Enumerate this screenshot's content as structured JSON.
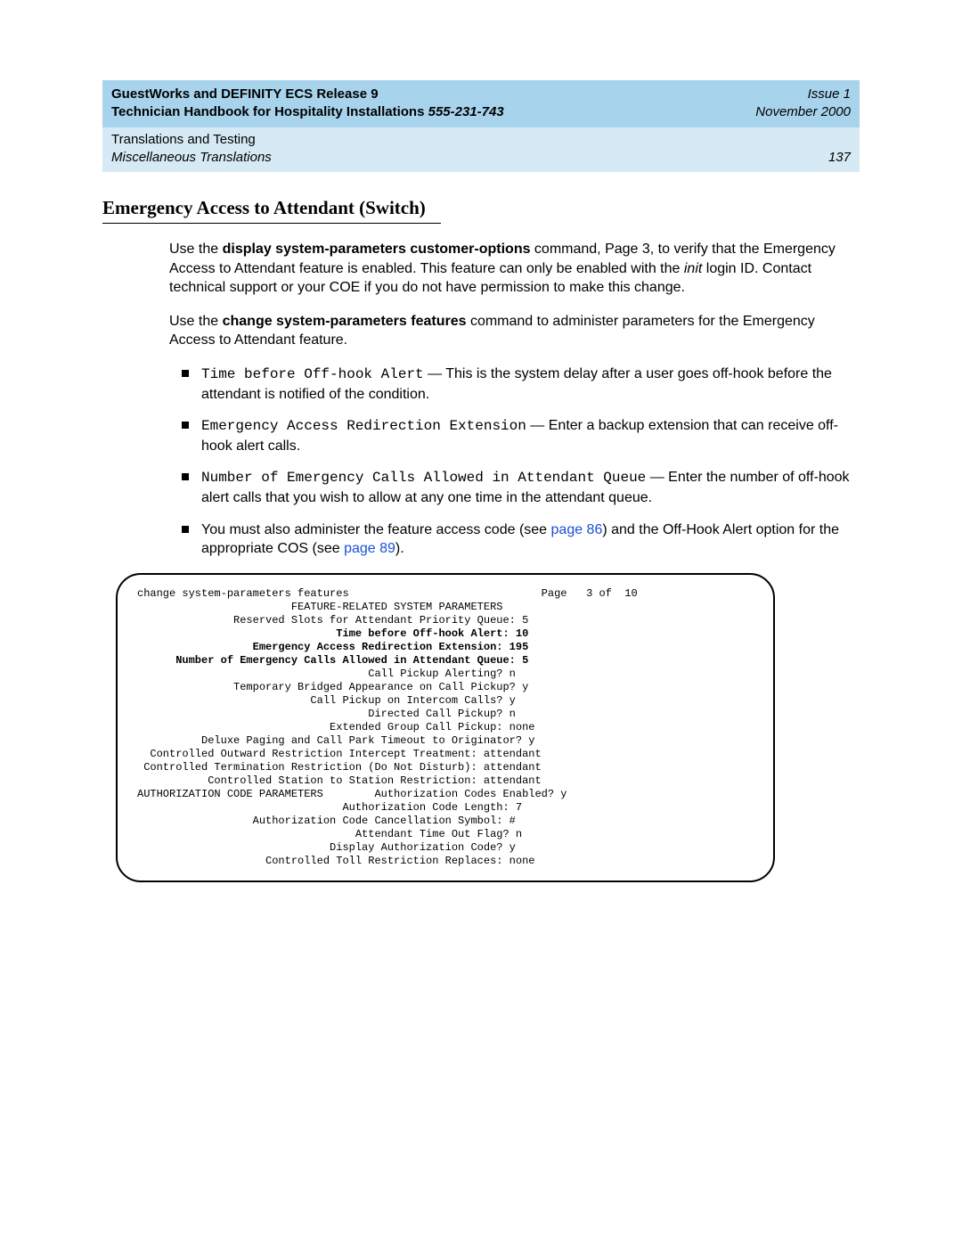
{
  "header": {
    "title_line1_a": "GuestWorks and DEFINITY ECS Release 9",
    "title_line2_a": "Technician Handbook for Hospitality Installations",
    "doc_number": "  555-231-743",
    "issue": "Issue 1",
    "date": "November 2000"
  },
  "subheader": {
    "chapter": "Translations and Testing",
    "section": "Miscellaneous Translations",
    "page_number": "137"
  },
  "section_title": "Emergency Access to Attendant (Switch)",
  "para1_a": "Use the ",
  "para1_b": "display system-parameters customer-options",
  "para1_c": " command, Page 3, to verify that the Emergency Access to Attendant feature is enabled. This feature can only be enabled with the ",
  "para1_d": "init",
  "para1_e": " login ID. Contact technical support or your COE if you do not have permission to make this change.",
  "para2_a": "Use the ",
  "para2_b": "change system-parameters features",
  "para2_c": " command to administer parameters for the Emergency Access to Attendant feature.",
  "bullets": [
    {
      "mono": "Time before Off-hook Alert",
      "rest": " — This is the system delay after a user goes off-hook before the attendant is notified of the condition."
    },
    {
      "mono": "Emergency Access Redirection Extension",
      "rest": " — Enter a backup extension that can receive off-hook alert calls."
    },
    {
      "mono": "Number of Emergency Calls Allowed in Attendant Queue",
      "rest": " — Enter the number of off-hook alert calls that you wish to allow at any one time in the attendant queue."
    }
  ],
  "bullet4_a": "You must also administer the feature access code (see ",
  "bullet4_link1": "page 86",
  "bullet4_b": ") and the Off-Hook Alert option for the appropriate COS (see ",
  "bullet4_link2": "page 89",
  "bullet4_c": ").",
  "terminal": {
    "l01": "change system-parameters features                              Page   3 of  10",
    "l02": "                        FEATURE-RELATED SYSTEM PARAMETERS",
    "l03": "               Reserved Slots for Attendant Priority Queue: 5",
    "l04": "                               Time before Off-hook Alert: 10",
    "l05": "                  Emergency Access Redirection Extension: 195",
    "l06": "      Number of Emergency Calls Allowed in Attendant Queue: 5",
    "l07": "                                    Call Pickup Alerting? n",
    "l08": "               Temporary Bridged Appearance on Call Pickup? y",
    "l09": "                           Call Pickup on Intercom Calls? y",
    "l10": "                                    Directed Call Pickup? n",
    "l11": "                              Extended Group Call Pickup: none",
    "l12": "          Deluxe Paging and Call Park Timeout to Originator? y",
    "l13": "  Controlled Outward Restriction Intercept Treatment: attendant",
    "l14": " Controlled Termination Restriction (Do Not Disturb): attendant",
    "l15": "           Controlled Station to Station Restriction: attendant",
    "l16a": "AUTHORIZATION CODE PARAMETERS",
    "l16b": "        Authorization Codes Enabled? y",
    "l17": "                                Authorization Code Length: 7",
    "l18": "                  Authorization Code Cancellation Symbol: #",
    "l19": "                                  Attendant Time Out Flag? n",
    "l20": "                              Display Authorization Code? y",
    "l21": "                    Controlled Toll Restriction Replaces: none"
  }
}
